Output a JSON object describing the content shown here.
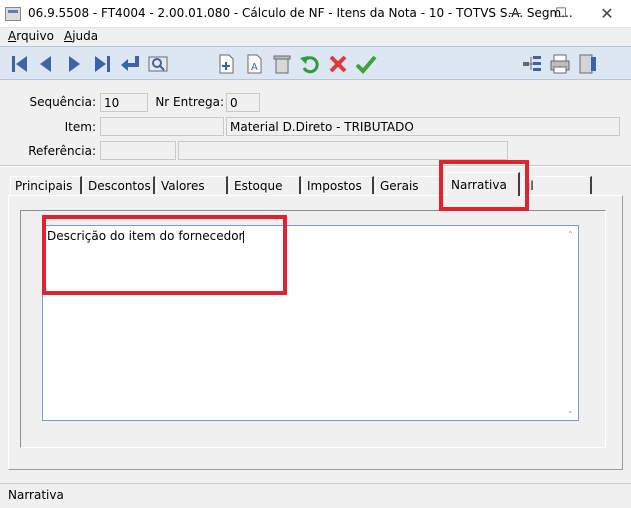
{
  "window": {
    "title": "06.9.5508 - FT4004 - 2.00.01.080 - Cálculo de NF - Itens da Nota - 10 - TOTVS S.A. Segm...",
    "minimize": "—",
    "maximize": "☐",
    "close": "✕"
  },
  "menu": {
    "items": [
      "Arquivo",
      "Ajuda"
    ]
  },
  "toolbar": {
    "buttons": [
      {
        "name": "first-record",
        "icon": "first-icon"
      },
      {
        "name": "previous-record",
        "icon": "previous-icon"
      },
      {
        "name": "next-record",
        "icon": "next-icon"
      },
      {
        "name": "last-record",
        "icon": "last-icon"
      },
      {
        "name": "goto",
        "icon": "enter-icon"
      },
      {
        "name": "search",
        "icon": "search-icon"
      },
      {
        "name": "new",
        "icon": "new-document-icon"
      },
      {
        "name": "edit",
        "icon": "edit-icon"
      },
      {
        "name": "delete",
        "icon": "trash-icon"
      },
      {
        "name": "undo",
        "icon": "undo-icon"
      },
      {
        "name": "cancel",
        "icon": "cancel-icon"
      },
      {
        "name": "confirm",
        "icon": "check-icon"
      },
      {
        "name": "tree",
        "icon": "tree-icon"
      },
      {
        "name": "print",
        "icon": "print-icon"
      },
      {
        "name": "exit",
        "icon": "exit-icon"
      }
    ]
  },
  "form": {
    "sequencia_label": "Sequência:",
    "sequencia_value": "10",
    "nr_entrega_label": "Nr Entrega:",
    "nr_entrega_value": "0",
    "item_label": "Item:",
    "item_code": "",
    "item_description": "Material D.Direto - TRIBUTADO",
    "referencia_label": "Referência:",
    "referencia_code": "",
    "referencia_description": ""
  },
  "tabs": {
    "items": [
      "Principais",
      "Descontos",
      "Valores",
      "Estoque",
      "Impostos",
      "Gerais",
      "Narrativa",
      "il"
    ],
    "active": "Narrativa"
  },
  "narrativa": {
    "text": "Descrição do item do fornecedor"
  },
  "status": {
    "text": "Narrativa"
  },
  "colors": {
    "highlight": "#e0232e",
    "toolbar_bg": "#dde6f3",
    "textarea_border": "#7a9ccf"
  }
}
